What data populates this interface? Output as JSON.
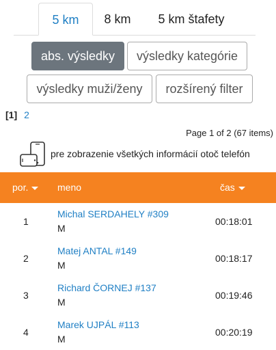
{
  "tabs": [
    {
      "label": "5 km",
      "active": true
    },
    {
      "label": "8 km",
      "active": false
    },
    {
      "label": "5 km štafety",
      "active": false
    }
  ],
  "filters": {
    "abs": "abs. výsledky",
    "category": "výsledky kategórie",
    "men_women": "výsledky muži/ženy",
    "advanced": "rozšírený filter"
  },
  "pagination": {
    "current": "[1]",
    "next": "2",
    "info": "Page 1 of 2 (67 items)"
  },
  "hint": {
    "text": "pre zobrazenie všetkých informácií otoč telefón",
    "icon": "phone-rotate-icon"
  },
  "table": {
    "headers": {
      "rank": "por.",
      "name": "meno",
      "time": "čas"
    },
    "rows": [
      {
        "rank": "1",
        "name": "Michal SERDAHELY #309",
        "category": "M",
        "time": "00:18:01"
      },
      {
        "rank": "2",
        "name": "Matej ANTAL #149",
        "category": "M",
        "time": "00:18:17"
      },
      {
        "rank": "3",
        "name": "Richard ČORNEJ #137",
        "category": "M",
        "time": "00:19:46"
      },
      {
        "rank": "4",
        "name": "Marek UJPÁL #113",
        "category": "M",
        "time": "00:20:19"
      }
    ]
  },
  "colors": {
    "accent": "#f58220",
    "link": "#1f7fc4",
    "active_button": "#6c757d"
  }
}
